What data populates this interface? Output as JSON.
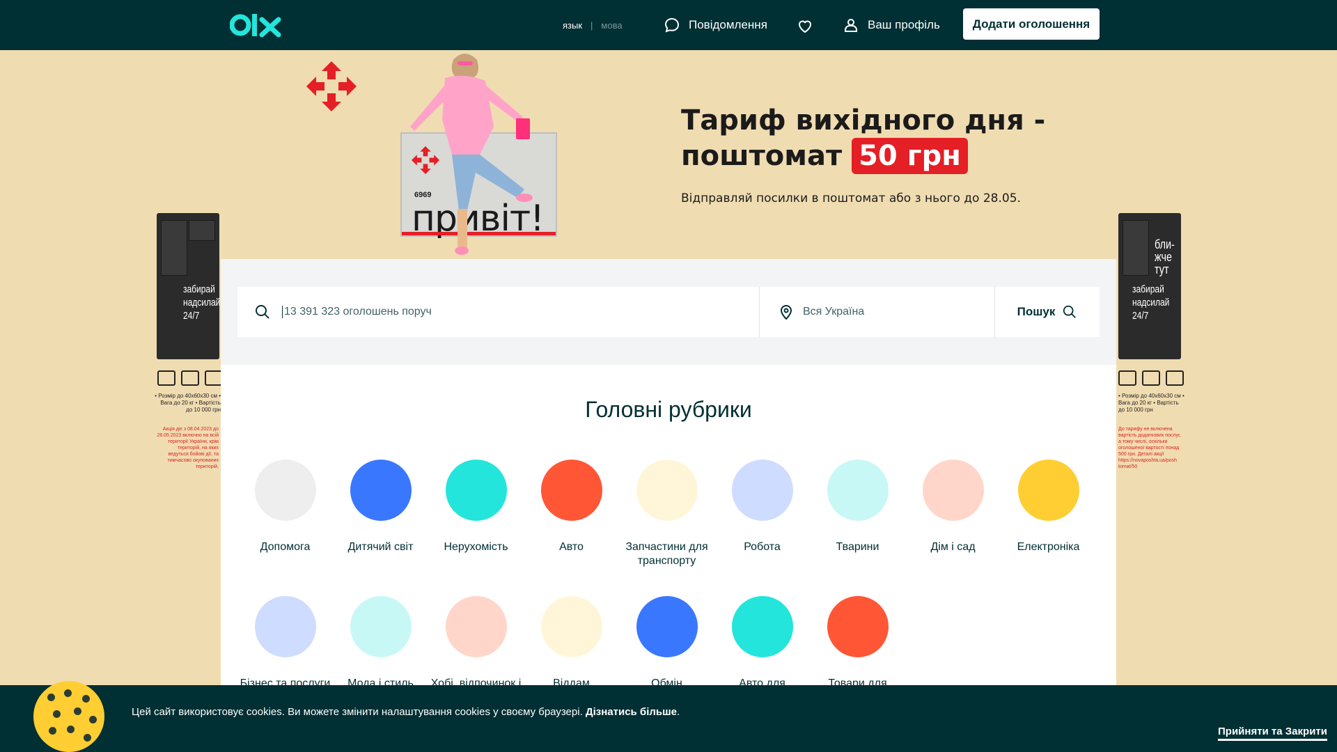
{
  "header": {
    "logo_text": "olx",
    "lang_ru": "язык",
    "lang_sep": "|",
    "lang_ua": "мова",
    "messages_label": "Повідомлення",
    "profile_label": "Ваш профіль",
    "add_button_label": "Додати оголошення"
  },
  "banner": {
    "title_line1": "Тариф вихідного дня -",
    "title_line2": "поштомат",
    "price": "50 грн",
    "subtitle": "Відправляй посилки в поштомат або з нього до 28.05.",
    "locker_text": "привіт!",
    "locker_number": "6969",
    "tower_left_text": "забирай надсилай 24/7",
    "tower_right_text": "забирай надсилай 24/7",
    "tower_right_top": "бли-жче тут",
    "side_notes": "• Розмір до 40х60х30 см • Вага до 20 кг • Вартість до 10 000 грн",
    "side_red_left": "Акція діє з 08.04.2023 до 28.05.2023 включно на всій території України, крім територій, на яких ведуться бойові дії, та тимчасово окупованих територій.",
    "side_red_right": "До тарифу не включена вартість додаткових послуг, а тому числі, оскільки оголошеної вартості понад 500 грн. Деталі акції https://novaposhta.ua/posh tomat/50"
  },
  "search": {
    "placeholder": "13 391 323 оголошень поруч",
    "location_placeholder": "Вся Україна",
    "button_label": "Пошук"
  },
  "categories_title": "Головні рубрики",
  "categories": [
    {
      "label": "Допомога",
      "color": "#eeeeee"
    },
    {
      "label": "Дитячий світ",
      "color": "#3a77ff"
    },
    {
      "label": "Нерухомість",
      "color": "#23e5db"
    },
    {
      "label": "Авто",
      "color": "#ff5636"
    },
    {
      "label": "Запчастини для транспорту",
      "color": "#fff6d9"
    },
    {
      "label": "Робота",
      "color": "#cedcff"
    },
    {
      "label": "Тварини",
      "color": "#c8f8f6"
    },
    {
      "label": "Дім і сад",
      "color": "#ffd6c9"
    },
    {
      "label": "Електроніка",
      "color": "#ffce32"
    },
    {
      "label": "Бізнес та послуги",
      "color": "#cedcff"
    },
    {
      "label": "Мода і стиль",
      "color": "#c8f8f6"
    },
    {
      "label": "Хобі, відпочинок і спорт",
      "color": "#ffd6c9"
    },
    {
      "label": "Віддам безкоштовно",
      "color": "#fff6d9"
    },
    {
      "label": "Обмін",
      "color": "#3a77ff"
    },
    {
      "label": "Авто для перемоги",
      "color": "#23e5db"
    },
    {
      "label": "Товари для перемоги",
      "color": "#ff5636"
    }
  ],
  "cookie": {
    "text": "Цей сайт використовує cookies. Ви можете змінити налаштування cookies у своєму браузері.",
    "link": "Дізнатись більше",
    "accept": "Прийняти та Закрити"
  }
}
